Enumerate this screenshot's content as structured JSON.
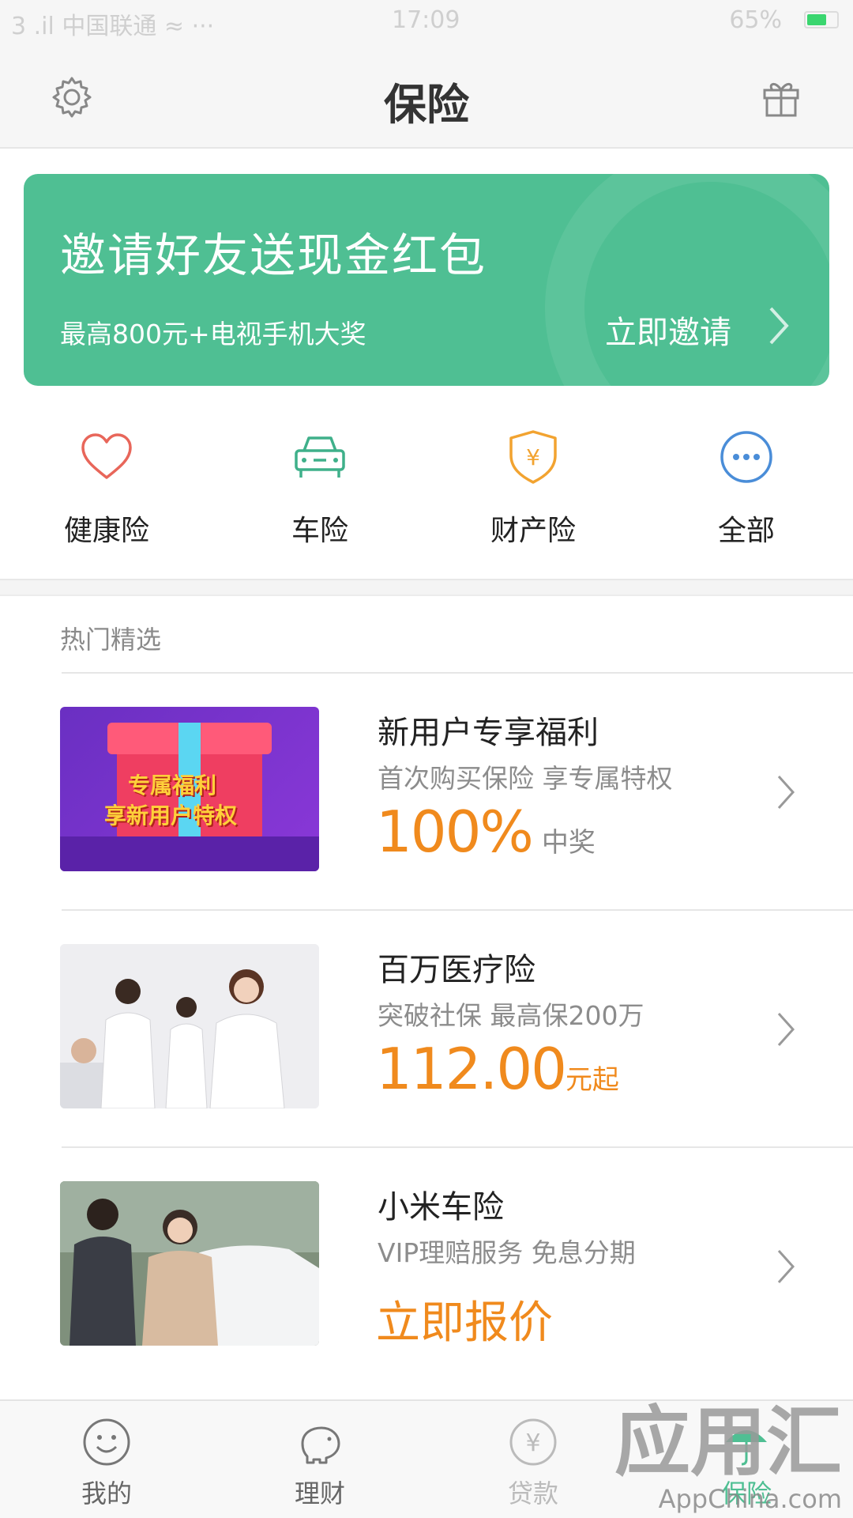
{
  "status_bar": {
    "carrier": "3 .il 中国联通 ≈ ···",
    "time": "17:09",
    "battery_text": "65%"
  },
  "header": {
    "title": "保险",
    "left_icon": "gear-icon",
    "right_icon": "gift-icon"
  },
  "banner": {
    "title": "邀请好友送现金红包",
    "subtitle": "最高800元+电视手机大奖",
    "cta": "立即邀请",
    "color": "#4fbf93"
  },
  "categories": [
    {
      "label": "健康险",
      "icon": "heart-icon",
      "color": "#e8665a"
    },
    {
      "label": "车险",
      "icon": "car-icon",
      "color": "#3fb08a"
    },
    {
      "label": "财产险",
      "icon": "shield-yen-icon",
      "color": "#f2a330"
    },
    {
      "label": "全部",
      "icon": "more-icon",
      "color": "#4a8dd8"
    }
  ],
  "section_title": "热门精选",
  "products": [
    {
      "title": "新用户专享福利",
      "subtitle": "首次购买保险 享专属特权",
      "price_number": "100%",
      "price_suffix": "中奖",
      "thumb_text_1": "专属福利",
      "thumb_text_2": "享新用户特权"
    },
    {
      "title": "百万医疗险",
      "subtitle": "突破社保 最高保200万",
      "price_number": "112.00",
      "price_suffix": "元起"
    },
    {
      "title": "小米车险",
      "subtitle": "VIP理赔服务 免息分期",
      "cta": "立即报价"
    }
  ],
  "tabs": [
    {
      "label": "我的",
      "icon": "smile-icon"
    },
    {
      "label": "理财",
      "icon": "piggy-bank-icon"
    },
    {
      "label": "贷款",
      "icon": "yen-icon"
    },
    {
      "label": "保险",
      "icon": "umbrella-icon",
      "active": true
    }
  ],
  "watermark": {
    "line1": "应用汇",
    "line2": "AppChina.com"
  },
  "accent_color": "#f08a1d"
}
